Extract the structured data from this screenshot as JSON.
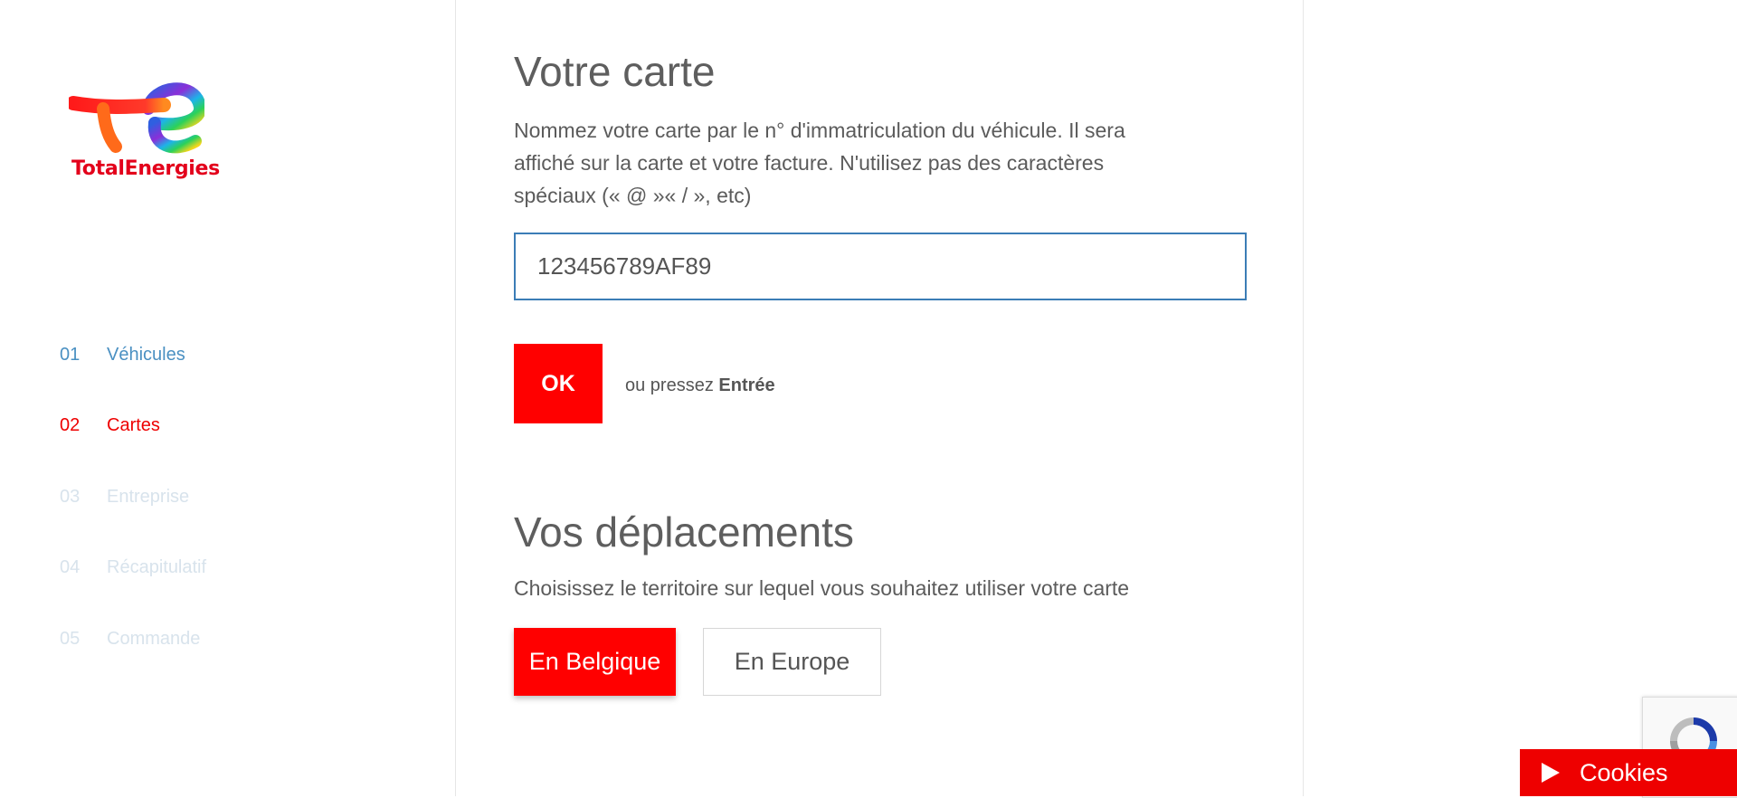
{
  "brand": {
    "name": "TotalEnergies",
    "color": "#e3001b"
  },
  "steps": [
    {
      "num": "01",
      "label": "Véhicules",
      "state": "done"
    },
    {
      "num": "02",
      "label": "Cartes",
      "state": "active"
    },
    {
      "num": "03",
      "label": "Entreprise",
      "state": "pending"
    },
    {
      "num": "04",
      "label": "Récapitulatif",
      "state": "pending"
    },
    {
      "num": "05",
      "label": "Commande",
      "state": "pending"
    }
  ],
  "card": {
    "title": "Votre carte",
    "description": "Nommez votre carte par le n° d'immatriculation du véhicule. Il sera affiché sur la carte et votre facture. N'utilisez pas des caractères spéciaux (« @ »« / », etc)",
    "input_value": "123456789AF89",
    "ok_label": "OK",
    "hint_prefix": "ou pressez",
    "hint_key": "Entrée"
  },
  "travel": {
    "title": "Vos déplacements",
    "description": "Choisissez le territoire sur lequel vous souhaitez utiliser votre carte",
    "options": [
      {
        "label": "En Belgique",
        "selected": true
      },
      {
        "label": "En Europe",
        "selected": false
      }
    ]
  },
  "cookies": {
    "label": "Cookies"
  },
  "colors": {
    "accent": "#ff0000",
    "link_blue": "#4a90c2",
    "input_border": "#3b7db6",
    "pending": "#d8e3ec"
  },
  "icons": {
    "logo": "totalenergies-logo",
    "recaptcha": "recaptcha-icon",
    "cookies": "play-icon"
  }
}
